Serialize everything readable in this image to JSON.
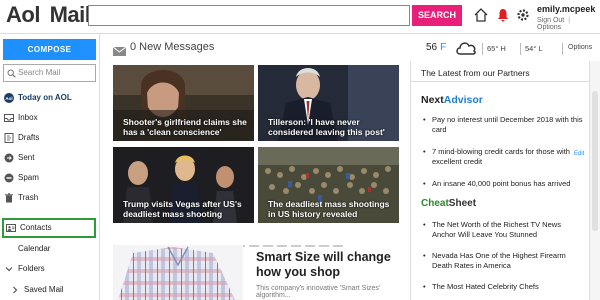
{
  "header": {
    "logo_main": "Aol",
    "logo_sub": "Mail.",
    "search_placeholder": "",
    "search_button": "SEARCH",
    "user_name": "emily.mcpeek",
    "sign_out": "Sign Out",
    "options": "Options"
  },
  "sidebar": {
    "compose": "COMPOSE",
    "search_placeholder": "Search Mail",
    "items": [
      {
        "label": "Today on AOL",
        "icon": "aol-icon"
      },
      {
        "label": "Inbox",
        "icon": "inbox-icon"
      },
      {
        "label": "Drafts",
        "icon": "drafts-icon"
      },
      {
        "label": "Sent",
        "icon": "sent-icon"
      },
      {
        "label": "Spam",
        "icon": "spam-icon"
      },
      {
        "label": "Trash",
        "icon": "trash-icon"
      },
      {
        "label": "Contacts",
        "icon": "contacts-icon"
      },
      {
        "label": "Calendar",
        "icon": "calendar-icon"
      },
      {
        "label": "Folders",
        "icon": "chevron-down-icon"
      },
      {
        "label": "Saved Mail",
        "icon": "chevron-right-icon"
      }
    ]
  },
  "main": {
    "messages": "0 New Messages",
    "news": [
      {
        "headline": "Shooter's girlfriend claims she has a 'clean conscience'"
      },
      {
        "headline": "Tillerson: 'I have never considered leaving this post'"
      },
      {
        "headline": "Trump visits Vegas after US's deadliest mass shooting"
      },
      {
        "headline": "The deadliest mass shootings in US history revealed"
      }
    ],
    "ad_title": "Smart Size will change how you shop",
    "ad_sub": "This company's innovative 'Smart Sizes' algorithm..."
  },
  "weather": {
    "temp": "56",
    "unit": "F",
    "high": "65° H",
    "low": "54° L",
    "options": "Options"
  },
  "partners": {
    "title": "The Latest from our Partners",
    "brand1_a": "Next",
    "brand1_b": "Advisor",
    "edit": "Edit",
    "items1": [
      "Pay no interest until December 2018 with this card",
      "7 mind-blowing credit cards for those with excellent credit",
      "An insane 40,000 point bonus has arrived"
    ],
    "brand2_a": "Cheat",
    "brand2_b": "Sheet",
    "items2": [
      "The Net Worth of the Richest TV News Anchor Will Leave You Stunned",
      "Nevada Has One of the Highest Firearm Death Rates in America",
      "The Most Hated Celebrity Chefs"
    ]
  },
  "colors": {
    "accent": "#1e90ff",
    "search_button": "#e8207a",
    "contacts_highlight": "#2e9b3b"
  }
}
